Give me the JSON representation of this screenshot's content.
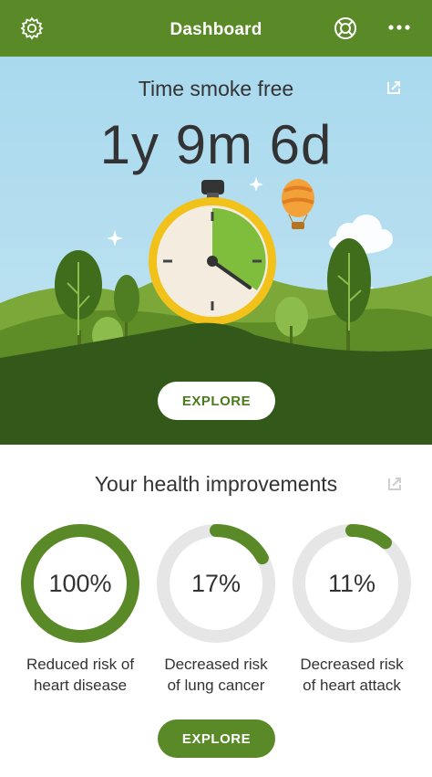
{
  "header": {
    "title": "Dashboard",
    "left_icon": "gear-icon",
    "right_icons": [
      "lifebuoy-icon",
      "more-icon"
    ],
    "color": "#5a8a27"
  },
  "hero": {
    "title": "Time smoke free",
    "duration": "1y 9m 6d",
    "button_label": "EXPLORE",
    "share_icon": "share-icon",
    "illustration": "stopwatch-landscape"
  },
  "health": {
    "title": "Your health improvements",
    "share_icon": "share-icon",
    "metrics": [
      {
        "percent": "100%",
        "value": 1.0,
        "label_line1": "Reduced risk of",
        "label_line2": "heart disease"
      },
      {
        "percent": "17%",
        "value": 0.17,
        "label_line1": "Decreased risk",
        "label_line2": "of lung cancer"
      },
      {
        "percent": "11%",
        "value": 0.11,
        "label_line1": "Decreased risk",
        "label_line2": "of heart attack"
      }
    ],
    "button_label": "EXPLORE",
    "ring_color": "#5a8a27",
    "track_color": "#e6e6e6"
  }
}
